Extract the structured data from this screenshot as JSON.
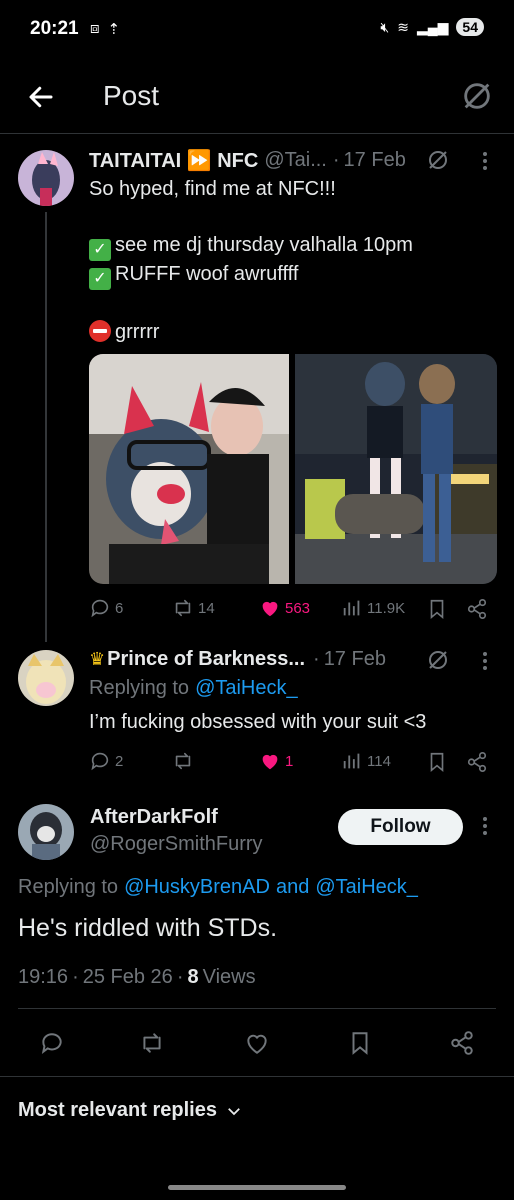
{
  "status_bar": {
    "time": "20:21",
    "battery": "54"
  },
  "header": {
    "title": "Post"
  },
  "post1": {
    "display_name": "TAITAITAI ⏩ NFC",
    "handle": "@Tai...",
    "dot": "·",
    "date": "17 Feb",
    "line1": "So hyped, find me at NFC!!!",
    "line2": "see me dj thursday valhalla 10pm",
    "line3": "RUFFF woof awruffff",
    "line4": "grrrrr",
    "replies": "6",
    "reposts": "14",
    "likes": "563",
    "views": "11.9K"
  },
  "post2": {
    "display_name": "Prince of Barkness...",
    "dot": "·",
    "date": "17 Feb",
    "replying_prefix": "Replying to",
    "replying_handle": "@TaiHeck_",
    "text": "I’m fucking obsessed with your suit <3",
    "replies": "2",
    "likes": "1",
    "views": "114"
  },
  "main_post": {
    "display_name": "AfterDarkFolf",
    "handle": "@RogerSmithFurry",
    "follow_label": "Follow",
    "replying_prefix": "Replying to",
    "replying_handle1": "@HuskyBrenAD",
    "replying_and": "and",
    "replying_handle2": "@TaiHeck_",
    "text": "He's riddled with STDs.",
    "time": "19:16",
    "dot1": "·",
    "date": "25 Feb 26",
    "dot2": "·",
    "views_count": "8",
    "views_label": "Views"
  },
  "sort": {
    "label": "Most relevant replies"
  },
  "colors": {
    "accent": "#1d9bf0",
    "like": "#f91880",
    "muted": "#71767b",
    "check": "#43b047"
  }
}
